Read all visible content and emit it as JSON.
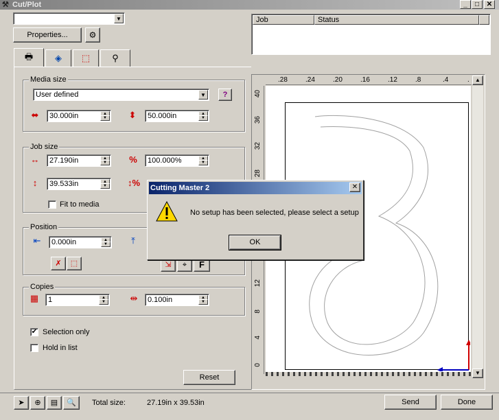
{
  "window": {
    "title": "Cut/Plot",
    "controls": [
      "_",
      "□",
      "✕"
    ]
  },
  "top": {
    "device_combo_value": "",
    "properties_label": "Properties...",
    "job_header": "Job",
    "status_header": "Status"
  },
  "tabs": [
    "tab-general",
    "tab-options",
    "tab-panels",
    "tab-tools"
  ],
  "media": {
    "group_label": "Media size",
    "type_value": "User defined",
    "width_value": "30.000in",
    "height_value": "50.000in"
  },
  "job": {
    "group_label": "Job size",
    "width_value": "27.190in",
    "width_percent": "100.000%",
    "height_value": "39.533in",
    "fit_to_media_label": "Fit to media"
  },
  "position": {
    "group_label": "Position",
    "x_value": "0.000in",
    "f_label": "F"
  },
  "copies": {
    "group_label": "Copies",
    "count_value": "1",
    "spacing_value": "0.100in"
  },
  "options": {
    "selection_only_label": "Selection only",
    "selection_only_checked": "✔",
    "hold_in_list_label": "Hold in list"
  },
  "buttons": {
    "reset": "Reset",
    "send": "Send",
    "done": "Done"
  },
  "status": {
    "total_size_label": "Total size:",
    "total_size_value": "27.19in x 39.53in"
  },
  "ruler_top": [
    ".28",
    ".24",
    ".20",
    ".16",
    ".12",
    ".8",
    ".4",
    "."
  ],
  "ruler_left": [
    "40",
    "36",
    "32",
    "28",
    "12",
    "8",
    "4",
    "0"
  ],
  "dialog": {
    "title": "Cutting Master 2",
    "message": "No setup has been selected, please select a setup",
    "ok_label": "OK"
  }
}
